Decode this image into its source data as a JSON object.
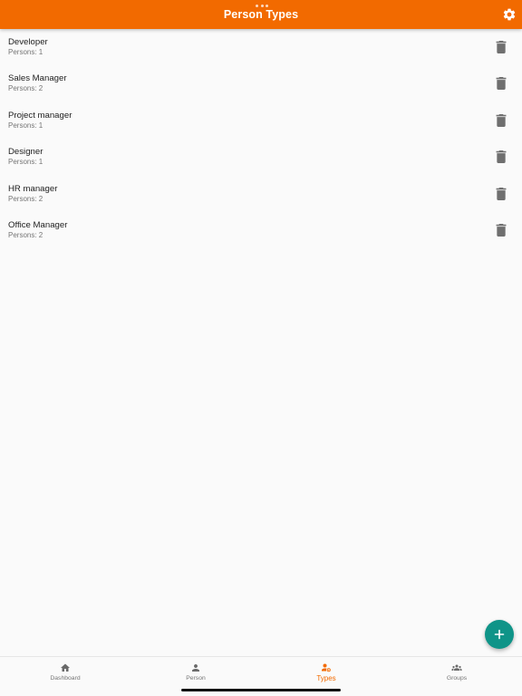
{
  "app_bar": {
    "title": "Person Types",
    "background": "#f26a00",
    "settings_icon": "gear-icon"
  },
  "person_types": [
    {
      "name": "Developer",
      "persons": "Persons: 1"
    },
    {
      "name": "Sales Manager",
      "persons": "Persons: 2"
    },
    {
      "name": "Project manager",
      "persons": "Persons: 1"
    },
    {
      "name": "Designer",
      "persons": "Persons: 1"
    },
    {
      "name": "HR manager",
      "persons": "Persons: 2"
    },
    {
      "name": "Office Manager",
      "persons": "Persons: 2"
    }
  ],
  "row_action_icon": "trash-icon",
  "fab": {
    "icon": "plus-icon",
    "color": "#0f9488"
  },
  "bottom_nav": {
    "items": [
      {
        "label": "Dashboard",
        "icon": "home-icon"
      },
      {
        "label": "Person",
        "icon": "person-icon"
      },
      {
        "label": "Types",
        "icon": "person-types-icon"
      },
      {
        "label": "Groups",
        "icon": "groups-icon"
      }
    ],
    "active": "Types",
    "active_color": "#f26a00",
    "inactive_color": "#757575"
  }
}
